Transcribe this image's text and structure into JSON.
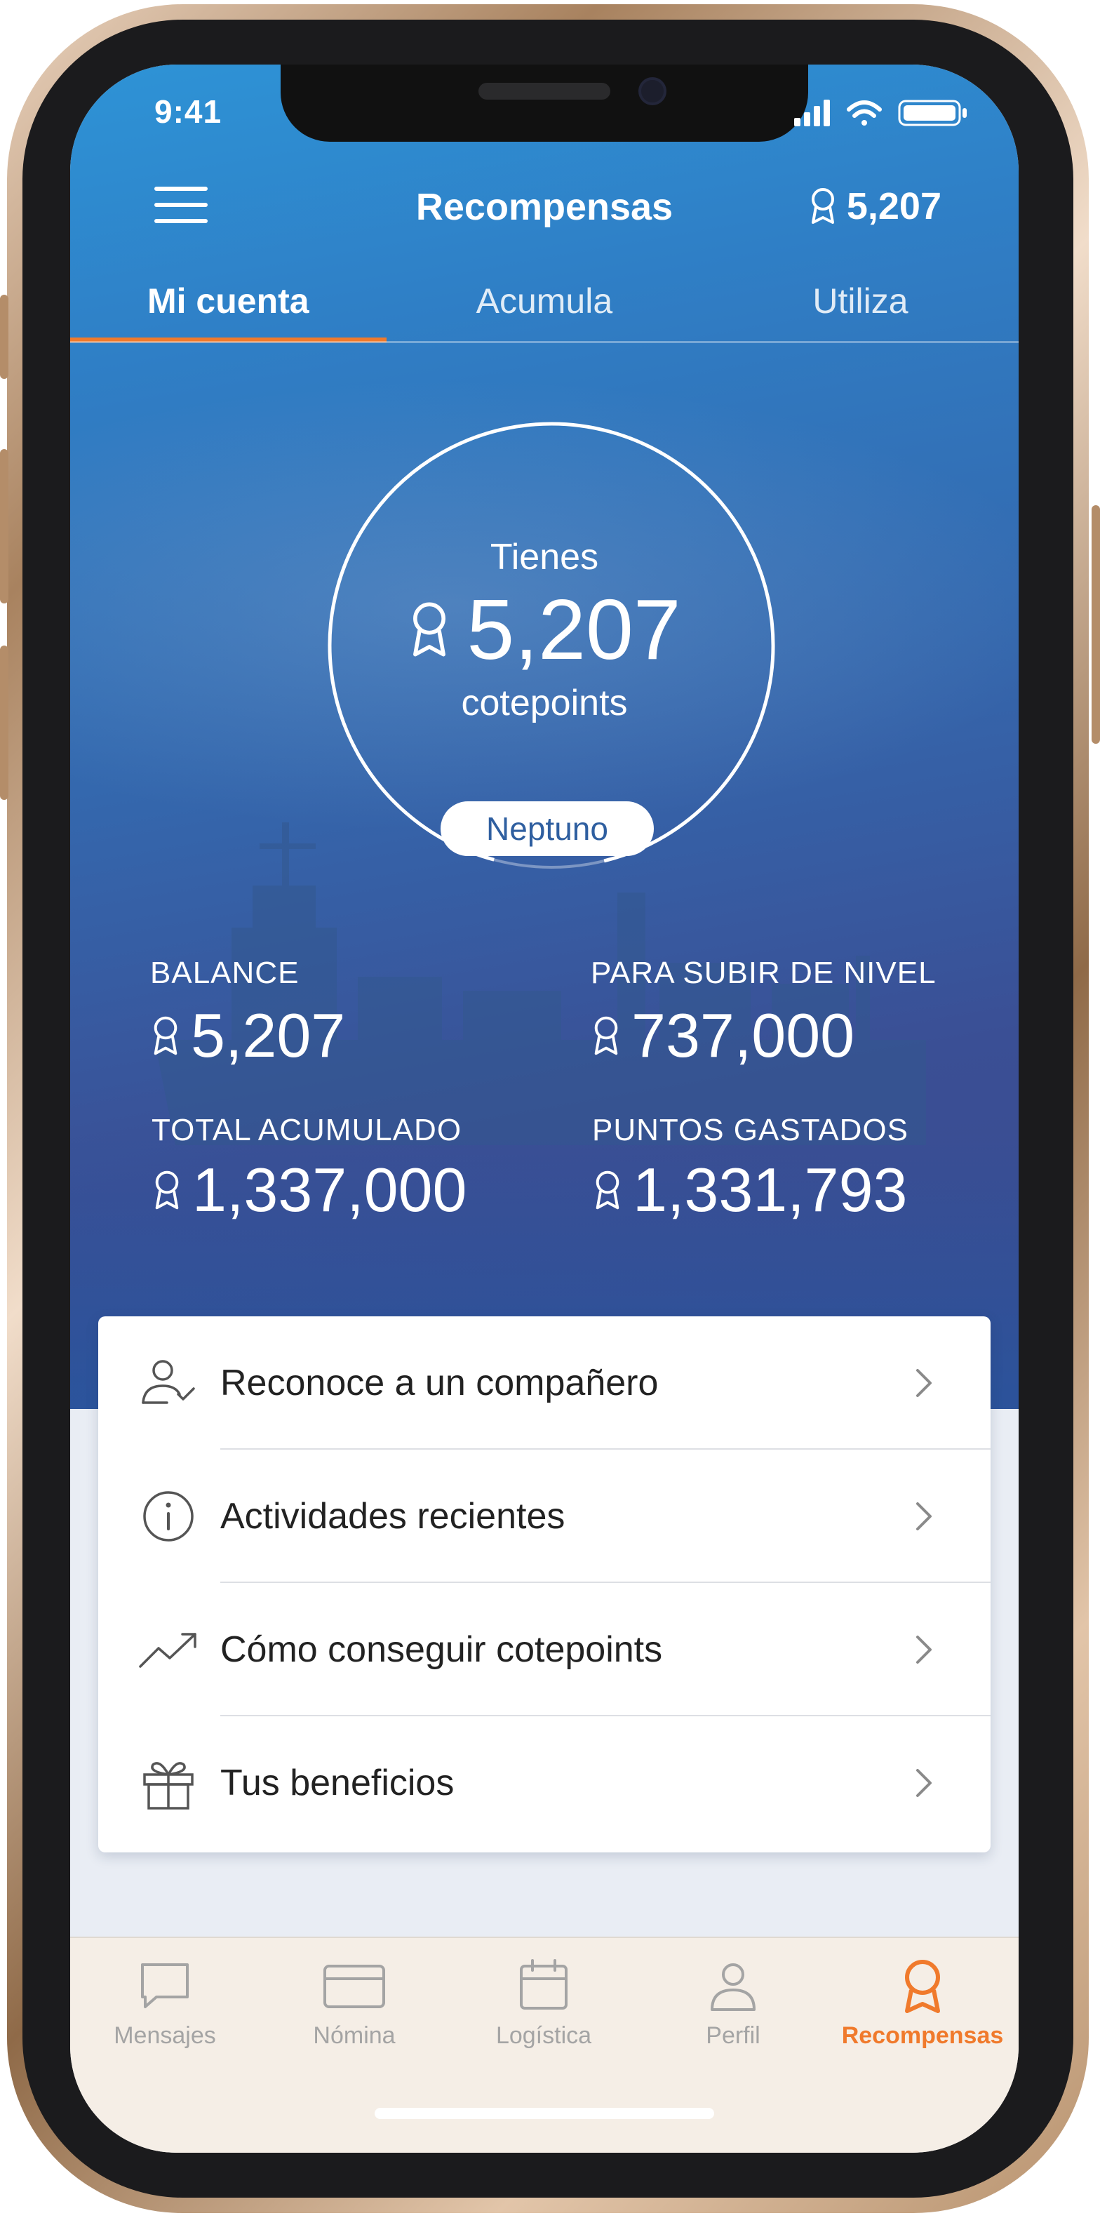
{
  "status": {
    "time": "9:41"
  },
  "header": {
    "title": "Recompensas",
    "points": "5,207"
  },
  "tabs": [
    {
      "label": "Mi cuenta",
      "active": true
    },
    {
      "label": "Acumula",
      "active": false
    },
    {
      "label": "Utiliza",
      "active": false
    }
  ],
  "summary": {
    "prefix": "Tienes",
    "points": "5,207",
    "unit": "cotepoints",
    "level": "Neptuno",
    "level_progress": 0.92
  },
  "stats": [
    {
      "label": "BALANCE",
      "value": "5,207"
    },
    {
      "label": "PARA SUBIR DE NIVEL",
      "value": "737,000"
    },
    {
      "label": "TOTAL ACUMULADO",
      "value": "1,337,000"
    },
    {
      "label": "PUNTOS GASTADOS",
      "value": "1,331,793"
    }
  ],
  "menu": [
    {
      "label": "Reconoce a un compañero",
      "icon": "user-check-icon"
    },
    {
      "label": "Actividades recientes",
      "icon": "info-icon"
    },
    {
      "label": "Cómo conseguir cotepoints",
      "icon": "trending-up-icon"
    },
    {
      "label": "Tus beneficios",
      "icon": "gift-icon"
    }
  ],
  "bottom_nav": [
    {
      "label": "Mensajes",
      "icon": "message-icon",
      "active": false
    },
    {
      "label": "Nómina",
      "icon": "credit-card-icon",
      "active": false
    },
    {
      "label": "Logística",
      "icon": "calendar-icon",
      "active": false
    },
    {
      "label": "Perfil",
      "icon": "user-icon",
      "active": false
    },
    {
      "label": "Recompensas",
      "icon": "award-icon",
      "active": true
    }
  ],
  "colors": {
    "accent": "#f07a2c",
    "hero_top": "#2e93d6",
    "hero_bottom": "#3b4a8e",
    "level_text": "#2f5fa0",
    "nav_inactive": "#a4a4a4"
  }
}
